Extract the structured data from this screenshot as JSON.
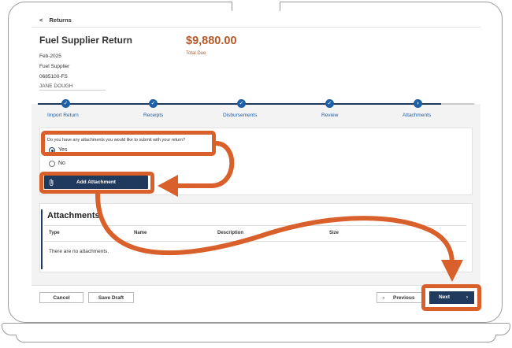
{
  "header": {
    "back_label": "Returns",
    "title": "Fuel Supplier Return",
    "period": "Feb-2025",
    "return_type": "Fuel Supplier",
    "account_id": "0685100-FS",
    "taxpayer": "JANE DOUGH",
    "amount": "$9,880.00",
    "amount_label": "Total Due"
  },
  "stepper": {
    "steps": [
      {
        "label": "Import Return",
        "status": "complete"
      },
      {
        "label": "Receipts",
        "status": "complete"
      },
      {
        "label": "Disbursements",
        "status": "complete"
      },
      {
        "label": "Review",
        "status": "complete"
      },
      {
        "label": "Attachments",
        "status": "current"
      }
    ],
    "check_glyph": "✓",
    "current_glyph": "›"
  },
  "question": {
    "text": "Do you have any attachments you would like to submit with your return?",
    "options": [
      {
        "label": "Yes",
        "selected": true
      },
      {
        "label": "No",
        "selected": false
      }
    ]
  },
  "add_attachment_label": "Add Attachment",
  "attachments": {
    "title": "Attachments",
    "columns": [
      "Type",
      "Name",
      "Description",
      "Size"
    ],
    "empty_text": "There are no attachments."
  },
  "footer": {
    "cancel_label": "Cancel",
    "save_draft_label": "Save Draft",
    "previous_label": "Previous",
    "next_label": "Next",
    "previous_glyph": "‹",
    "next_glyph": "›"
  },
  "colors": {
    "primary": "#1f3a5c",
    "accent": "#d95f2b",
    "amount": "#b5582a",
    "step": "#1f5fa8"
  },
  "icons": {
    "back": "chevron-left-icon",
    "attachment": "paperclip-icon",
    "steps": "check-icon"
  }
}
